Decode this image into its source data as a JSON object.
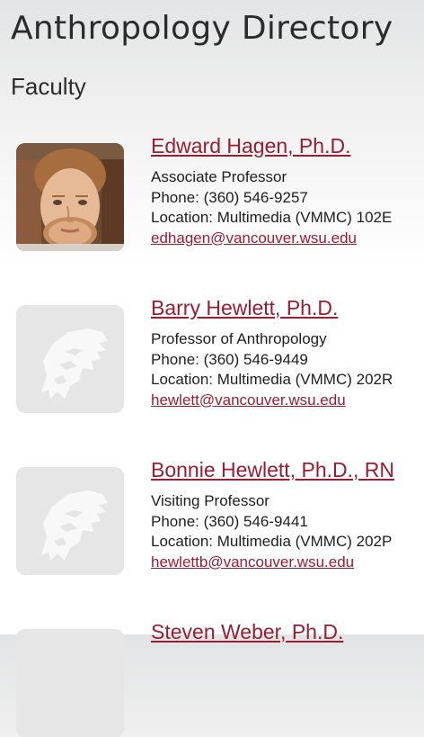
{
  "page": {
    "title": "Anthropology Directory",
    "section": "Faculty"
  },
  "faculty": [
    {
      "name": "Edward Hagen, Ph.D.",
      "title": "Associate Professor",
      "phone": "Phone: (360) 546-9257",
      "location": "Location: Multimedia (VMMC) 102E",
      "email": "edhagen@vancouver.wsu.edu",
      "photo": "portrait-photo"
    },
    {
      "name": "Barry Hewlett, Ph.D.",
      "title": "Professor of Anthropology",
      "phone": "Phone: (360) 546-9449",
      "location": "Location: Multimedia (VMMC) 202R",
      "email": "hewlett@vancouver.wsu.edu",
      "photo": "wsu-cougar-logo-placeholder"
    },
    {
      "name": "Bonnie Hewlett, Ph.D., RN",
      "title": "Visiting Professor",
      "phone": "Phone: (360) 546-9441",
      "location": "Location: Multimedia (VMMC) 202P",
      "email": "hewlettb@vancouver.wsu.edu",
      "photo": "wsu-cougar-logo-placeholder"
    },
    {
      "name": "Steven Weber, Ph.D.",
      "photo": "wsu-cougar-logo-placeholder"
    }
  ],
  "colors": {
    "link": "#981e32",
    "placeholder_bg": "#e6e6e6",
    "placeholder_logo": "#f7f7f7"
  }
}
